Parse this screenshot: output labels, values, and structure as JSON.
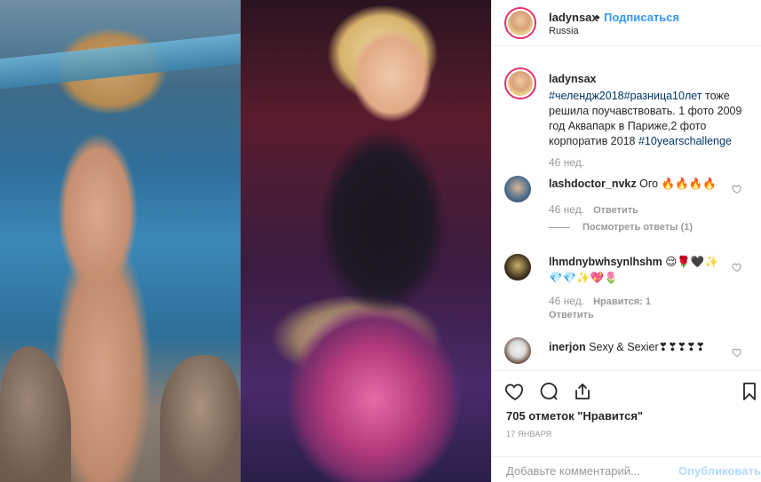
{
  "post": {
    "username": "ladynsax",
    "follow_label": "Подписаться",
    "dot": "•",
    "location": "Russia",
    "caption": {
      "username": "ladynsax",
      "tags1": "#челендж2018#разница10лет",
      "text1": " тоже решила поучавствовать. 1 фото 2009 год Аквапарк в Париже,2 фото корпоратив 2018 ",
      "tags2": "#10yearschallenge",
      "time": "46 нед."
    },
    "comments": [
      {
        "username": "lashdoctor_nvkz",
        "text": "Ого 🔥🔥🔥🔥",
        "time": "46 нед.",
        "reply_label": "Ответить",
        "likes_label": ""
      },
      {
        "username": "lhmdnybwhsynlhshm",
        "text": "😌🌹🖤✨💎💎✨💖🌷",
        "time": "46 нед.",
        "reply_label": "Ответить",
        "likes_label": "Нравится: 1"
      },
      {
        "username": "inerjon",
        "text": "Sexy & Sexier❣❣❣❣❣",
        "time": "",
        "reply_label": "",
        "likes_label": ""
      }
    ],
    "view_replies": "Посмотреть ответы (1)",
    "likes": "705 отметок \"Нравится\"",
    "date": "17 ЯНВАРЯ",
    "comment_placeholder": "Добавьте комментарий...",
    "publish_label": "Опубликовать"
  },
  "icons": {
    "like": "heart-icon",
    "comment": "comment-icon",
    "share": "share-icon",
    "save": "bookmark-icon"
  },
  "colors": {
    "link": "#3897f0",
    "hashtag": "#003569",
    "muted": "#999999",
    "publish_disabled": "#b3dbff"
  }
}
